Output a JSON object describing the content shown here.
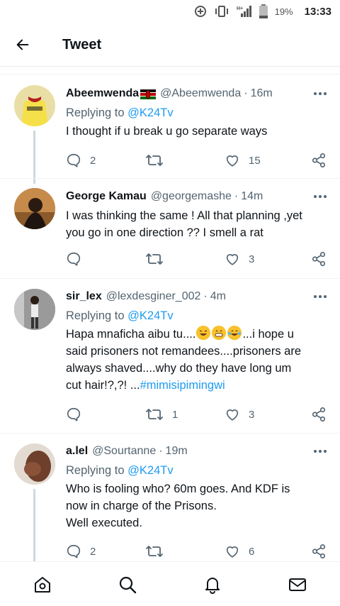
{
  "status_bar": {
    "battery": "19%",
    "time": "13:33",
    "network": "H+"
  },
  "header": {
    "title": "Tweet"
  },
  "replies": [
    {
      "name": "Abeemwenda",
      "handle": "@Abeemwenda",
      "time": "16m",
      "replying_prefix": "Replying to ",
      "replying_to": "@K24Tv",
      "text": "I thought if u break u go separate ways",
      "reply_count": "2",
      "retweet_count": "",
      "like_count": "15"
    },
    {
      "name": "George Kamau",
      "handle": "@georgemashe",
      "time": "14m",
      "text_line1": "I was thinking the same ! All that planning ,yet",
      "text_line2": "you go in one direction ?? I smell a rat",
      "reply_count": "",
      "retweet_count": "",
      "like_count": "3"
    },
    {
      "name": "sir_lex",
      "handle": "@lexdesginer_002",
      "time": "4m",
      "replying_prefix": "Replying to ",
      "replying_to": "@K24Tv",
      "text_start": "Hapa mnaficha aibu tu....",
      "text_after_emoji": "...i hope u",
      "text_line2": "said prisoners not remandees....prisoners are",
      "text_line3": "always shaved....why do they have long um",
      "text_line4": "cut hair!?,?! ...",
      "hashtag": "#mimisipimingwi",
      "reply_count": "",
      "retweet_count": "1",
      "like_count": "3"
    },
    {
      "name": "a.lel",
      "handle": "@Sourtanne",
      "time": "19m",
      "replying_prefix": "Replying to ",
      "replying_to": "@K24Tv",
      "text_line1": "Who is fooling who? 60m goes. And KDF is",
      "text_line2": "now in charge of the Prisons.",
      "text_line3": "Well executed.",
      "reply_count": "2",
      "retweet_count": "",
      "like_count": "6"
    }
  ],
  "separator": "·",
  "colors": {
    "accent": "#1d9bf0",
    "secondary_text": "#536471",
    "primary_text": "#0f1419",
    "divider": "#eff3f4"
  },
  "icons": {
    "nav": [
      "home-icon",
      "search-icon",
      "notifications-icon",
      "messages-icon"
    ],
    "actions": [
      "reply-icon",
      "retweet-icon",
      "like-icon",
      "share-icon"
    ]
  }
}
